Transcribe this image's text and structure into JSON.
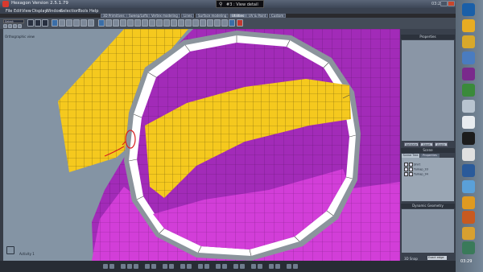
{
  "window": {
    "title": "Hexagon Version 2.5.1.79",
    "time": "03:28"
  },
  "search": {
    "text": "#3 : View detail"
  },
  "menu": [
    "File",
    "Edit",
    "View",
    "Display",
    "Window",
    "Selection",
    "Tools",
    "Help"
  ],
  "room_tabs": [
    "3D Primitives",
    "Sweep/Lofts",
    "Vertex modeling",
    "Lines",
    "Surface modeling",
    "Utilities",
    "UV & Paint",
    "Custom"
  ],
  "active_room_tab": "Utilities",
  "toolbar": {
    "selection_mode": "Select"
  },
  "viewport": {
    "label": "Orthographic view",
    "activity_label": "Activity 1"
  },
  "panels": {
    "properties": {
      "title": "Properties",
      "buttons": [
        "Validate",
        "Abort",
        "Apply"
      ]
    },
    "scene": {
      "title": "Scene",
      "tabs": [
        "Scene Tree",
        "Properties"
      ],
      "items": [
        "Shirt",
        "Tumap_33",
        "Tumap_34"
      ]
    },
    "dynamic_geometry": {
      "title": "Dynamic Geometry"
    },
    "snap": {
      "label": "3D Snap",
      "value": "Exact edge"
    }
  },
  "taskbar": {
    "time": "03:29"
  },
  "colors": {
    "yellow_mesh": "#f5c91e",
    "purple_mesh": "#a22bb8",
    "magenta_mesh": "#d23ed8",
    "ring_white": "#ffffff",
    "ring_gray": "#8b949c",
    "viewport_bg": "#8494a4"
  }
}
